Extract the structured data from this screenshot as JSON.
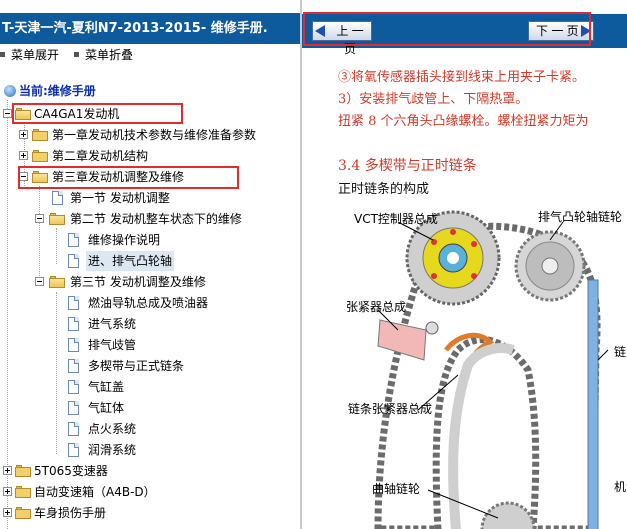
{
  "window": {
    "title": "T-天津一汽-夏利N7-2013-2015- 维修手册."
  },
  "menu": {
    "expand_label": "菜单展开",
    "collapse_label": "菜单折叠"
  },
  "tree": {
    "current_label": "当前:维修手册",
    "items": [
      {
        "label": "CA4GA1发动机"
      },
      {
        "label": "第一章发动机技术参数与维修准备参数"
      },
      {
        "label": "第二章发动机结构"
      },
      {
        "label": "第三章发动机调整及维修"
      },
      {
        "label": "第一节 发动机调整"
      },
      {
        "label": "第二节 发动机整车状态下的维修"
      },
      {
        "label": "维修操作说明"
      },
      {
        "label": "进、排气凸轮轴"
      },
      {
        "label": "第三节 发动机调整及维修"
      },
      {
        "label": "燃油导轨总成及喷油器"
      },
      {
        "label": "进气系统"
      },
      {
        "label": "排气歧管"
      },
      {
        "label": "多楔带与正式链条"
      },
      {
        "label": "气缸盖"
      },
      {
        "label": "气缸体"
      },
      {
        "label": "点火系统"
      },
      {
        "label": "润滑系统"
      },
      {
        "label": "5T065变速器"
      },
      {
        "label": "自动变速箱（A4B-D）"
      },
      {
        "label": "车身损伤手册"
      }
    ]
  },
  "nav": {
    "prev_label": "上 一 页",
    "next_label": "下 一 页"
  },
  "content": {
    "lines": [
      "③将氧传感器插头接到线束上用夹子卡紧。",
      "3）安装排气歧管上、下隔热罩。",
      "扭紧 8 个六角头凸缘螺栓。螺栓扭紧力矩为",
      "3.4 多楔带与正时链条",
      "正时链条的构成"
    ],
    "figure_labels": {
      "vct": "VCT控制器总成",
      "exhaust_cam": "排气凸轮轴链轮",
      "tensioner": "张紧器总成",
      "chain_tensioner": "链条张紧器总成",
      "crank": "曲轴链轮",
      "right_chain": "链",
      "right_bottom": "机油"
    }
  },
  "colors": {
    "title_bar": "#0d5a9c",
    "highlight": "#e32b2b",
    "red_text": "#d23a2a",
    "selected": "#dde7f3"
  }
}
